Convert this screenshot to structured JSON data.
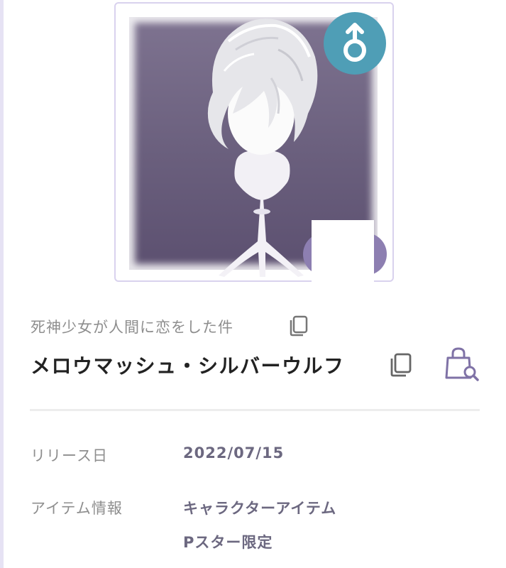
{
  "item": {
    "series_title": "死神少女が人間に恋をした件",
    "name": "メロウマッシュ・シルバーウルフ",
    "gender_icon": "male-symbol-icon",
    "gender_badge_color": "#4f9eb6"
  },
  "details": {
    "release_label": "リリース日",
    "release_value": "2022/07/15",
    "info_label": "アイテム情報",
    "info_values": [
      "キャラクターアイテム",
      "Pスター限定"
    ]
  },
  "icons": {
    "copy_series": "copy-icon",
    "copy_name": "copy-icon",
    "shop_search": "shopping-bag-search-icon"
  },
  "colors": {
    "border": "#d9d2ee",
    "accent_purple": "#8d7fb1",
    "value_text": "#6c6880"
  }
}
